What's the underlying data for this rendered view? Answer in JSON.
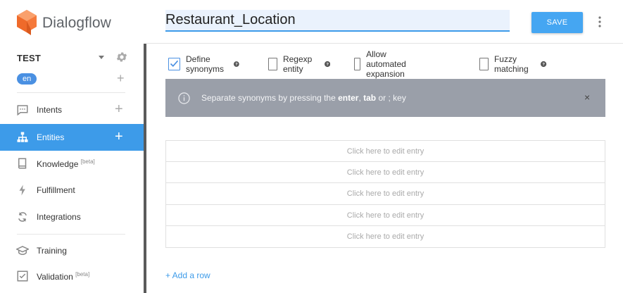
{
  "brand": {
    "name": "Dialogflow"
  },
  "agent": {
    "name": "TEST",
    "language": "en"
  },
  "nav": [
    {
      "id": "intents",
      "label": "Intents",
      "icon": "chat-bubble-icon",
      "plus": true,
      "active": false
    },
    {
      "id": "entities",
      "label": "Entities",
      "icon": "sitemap-icon",
      "plus": true,
      "active": true
    },
    {
      "id": "knowledge",
      "label": "Knowledge",
      "badge": "[beta]",
      "icon": "book-icon",
      "plus": false,
      "active": false
    },
    {
      "id": "fulfillment",
      "label": "Fulfillment",
      "icon": "bolt-icon",
      "plus": false,
      "active": false
    },
    {
      "id": "integrations",
      "label": "Integrations",
      "icon": "sync-icon",
      "plus": false,
      "active": false
    },
    {
      "id": "training",
      "label": "Training",
      "icon": "graduation-cap-icon",
      "plus": false,
      "active": false
    },
    {
      "id": "validation",
      "label": "Validation",
      "badge": "[beta]",
      "icon": "checkbox-icon",
      "plus": false,
      "active": false
    }
  ],
  "entity": {
    "name": "Restaurant_Location"
  },
  "toolbar": {
    "save_label": "SAVE"
  },
  "options": [
    {
      "label": "Define synonyms",
      "checked": true,
      "help": true
    },
    {
      "label": "Regexp entity",
      "checked": false,
      "help": true
    },
    {
      "label": "Allow automated expansion",
      "checked": false,
      "help": false
    },
    {
      "label": "Fuzzy matching",
      "checked": false,
      "help": true
    }
  ],
  "banner": {
    "text_before": "Separate synonyms by pressing the ",
    "key_enter": "enter",
    "sep1": ", ",
    "key_tab": "tab",
    "sep2": " or ",
    "key_semicolon": ";",
    "text_after": " key",
    "close": "×"
  },
  "entries": [
    {
      "placeholder": "Click here to edit entry"
    },
    {
      "placeholder": "Click here to edit entry"
    },
    {
      "placeholder": "Click here to edit entry"
    },
    {
      "placeholder": "Click here to edit entry"
    },
    {
      "placeholder": "Click here to edit entry"
    }
  ],
  "add_row_label": "+ Add a row",
  "colors": {
    "accent": "#3d9be9",
    "logo": "#f5793b",
    "banner": "#9a9fa9"
  }
}
